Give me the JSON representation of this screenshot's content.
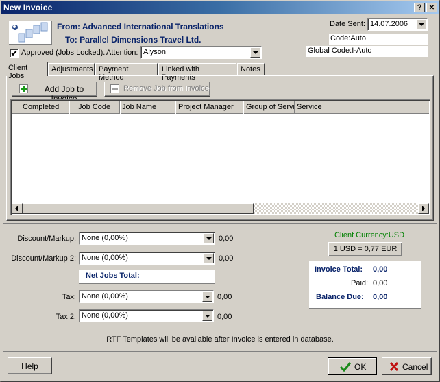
{
  "window": {
    "title": "New Invoice",
    "help_button": "?",
    "close_button": "✕"
  },
  "header": {
    "from_label": "From:",
    "from_value": "Advanced International Translations",
    "to_label": "To:",
    "to_value": "Parallel Dimensions Travel Ltd.",
    "approved_checked": true,
    "approved_label": "Approved (Jobs Locked).",
    "attention_label": "Attention:",
    "attention_value": "Alyson",
    "date_sent_label": "Date Sent:",
    "date_sent_value": "14.07.2006",
    "code": "Code:Auto",
    "global_code": "Global Code:I-Auto"
  },
  "tabs": [
    {
      "label": "Client Jobs",
      "active": true
    },
    {
      "label": "Adjustments",
      "active": false
    },
    {
      "label": "Payment Method",
      "active": false
    },
    {
      "label": "Linked with Payments",
      "active": false
    },
    {
      "label": "Notes",
      "active": false
    }
  ],
  "client_jobs": {
    "add_button": "Add Job to Invoice",
    "remove_button": "Remove Job from Invoice",
    "columns": [
      "Completed",
      "Job Code",
      "Job Name",
      "Project Manager",
      "Group of Servi",
      "Service"
    ],
    "rows": []
  },
  "adjustments": {
    "discount1_label": "Discount/Markup:",
    "discount1_value": "None (0,00%)",
    "discount1_amount": "0,00",
    "discount2_label": "Discount/Markup 2:",
    "discount2_value": "None (0,00%)",
    "discount2_amount": "0,00",
    "net_jobs_total_label": "Net Jobs Total:",
    "tax1_label": "Tax:",
    "tax1_value": "None (0,00%)",
    "tax1_amount": "0,00",
    "tax2_label": "Tax 2:",
    "tax2_value": "None (0,00%)",
    "tax2_amount": "0,00"
  },
  "currency": {
    "client_currency": "Client Currency:USD",
    "exchange_rate_button": "1 USD = 0,77 EUR",
    "color": "#008000"
  },
  "totals": {
    "invoice_total_label": "Invoice Total:",
    "invoice_total_value": "0,00",
    "paid_label": "Paid:",
    "paid_value": "0,00",
    "balance_due_label": "Balance Due:",
    "balance_due_value": "0,00"
  },
  "status_message": "RTF Templates will be available after Invoice is entered in database.",
  "footer": {
    "help_button": "Help",
    "ok_button": "OK",
    "cancel_button": "Cancel"
  }
}
